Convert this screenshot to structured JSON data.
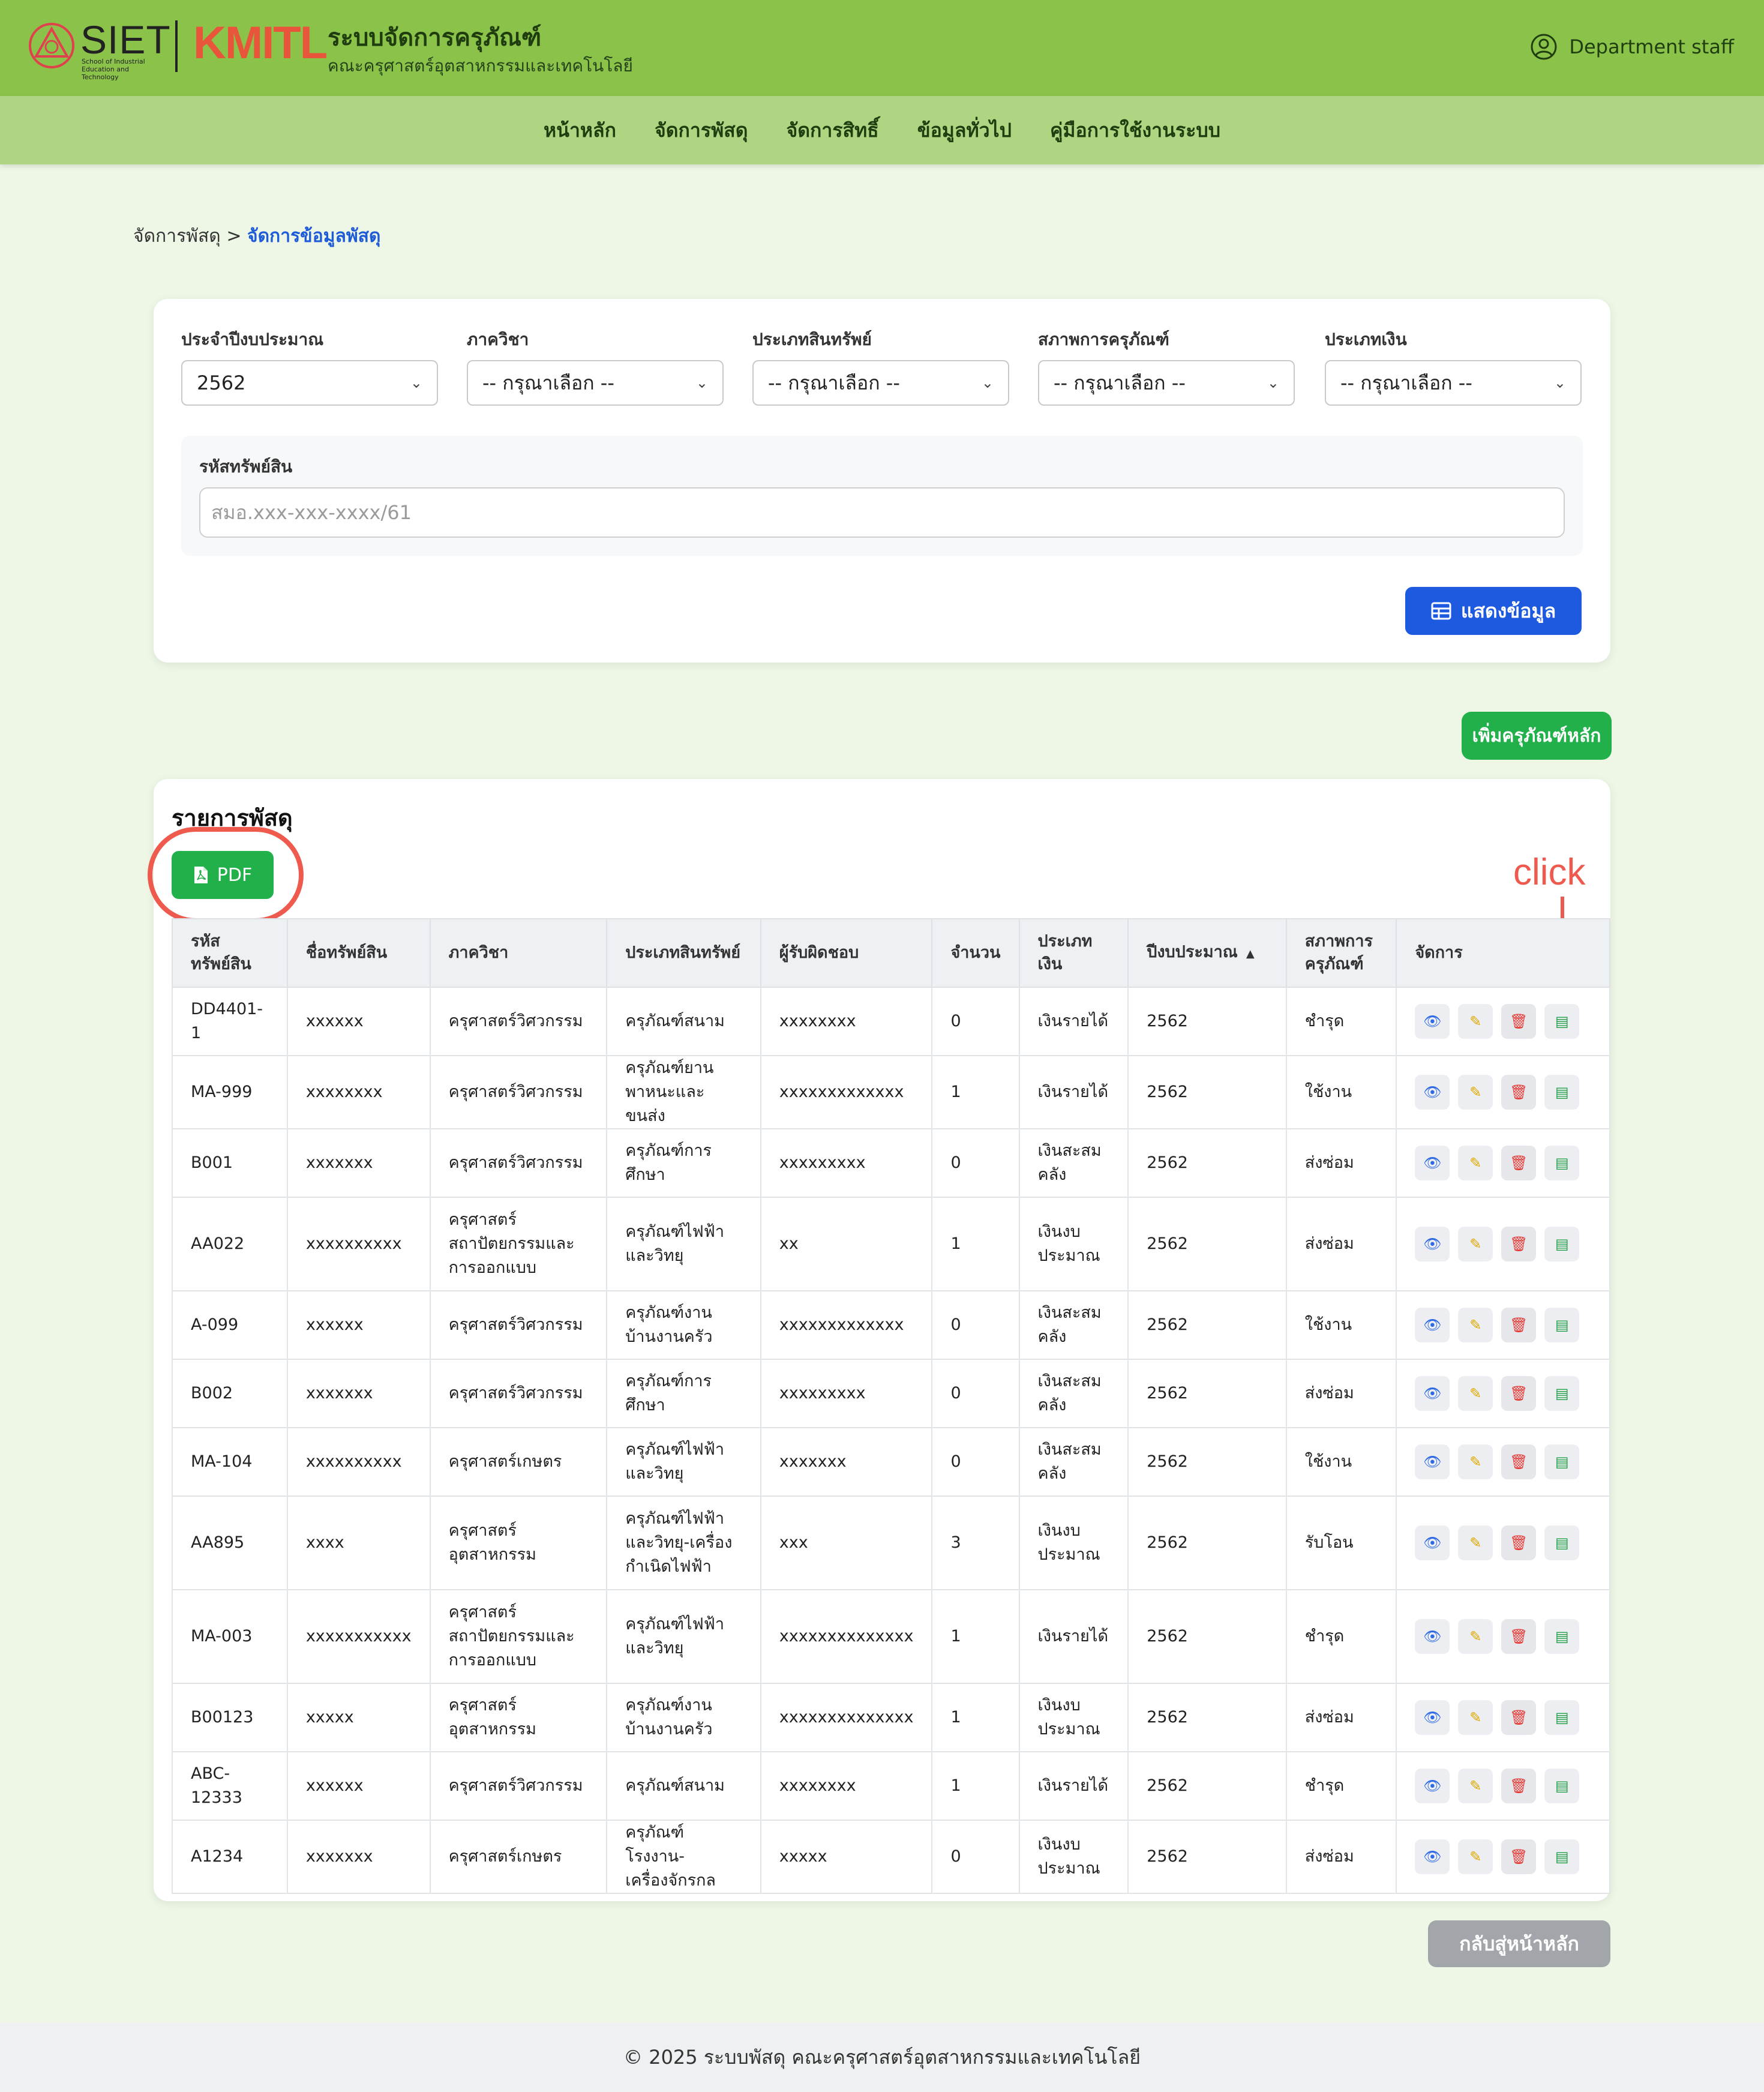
{
  "header": {
    "logo_siet": "SIET",
    "logo_siet_sub": "School of Industrial Education and Technology",
    "logo_kmitl": "KMITL",
    "system_title": "ระบบจัดการครุภัณฑ์",
    "system_subtitle": "คณะครุศาสตร์อุตสาหกรรมและเทคโนโลยี",
    "user_label": "Department staff"
  },
  "nav": {
    "items": [
      "หน้าหลัก",
      "จัดการพัสดุ",
      "จัดการสิทธิ์",
      "ข้อมูลทั่วไป",
      "คู่มือการใช้งานระบบ"
    ]
  },
  "breadcrumb": {
    "parent": "จัดการพัสดุ",
    "separator": ">",
    "current": "จัดการข้อมูลพัสดุ"
  },
  "filters": {
    "fiscal_year_label": "ประจำปีงบประมาณ",
    "fiscal_year_value": "2562",
    "department_label": "ภาควิชา",
    "department_value": "-- กรุณาเลือก --",
    "asset_type_label": "ประเภทสินทรัพย์",
    "asset_type_value": "-- กรุณาเลือก --",
    "condition_label": "สภาพการครุภัณฑ์",
    "condition_value": "-- กรุณาเลือก --",
    "money_type_label": "ประเภทเงิน",
    "money_type_value": "-- กรุณาเลือก --",
    "asset_code_label": "รหัสทรัพย์สิน",
    "asset_code_placeholder": "สมอ.xxx-xxx-xxxx/61",
    "show_button": "แสดงข้อมูล"
  },
  "add_button": "เพิ่มครุภัณฑ์หลัก",
  "list": {
    "title": "รายการพัสดุ",
    "pdf_button": "PDF",
    "annotation": "click",
    "columns": [
      "รหัส ทรัพย์สิน",
      "ชื่อทรัพย์สิน",
      "ภาควิชา",
      "ประเภทสินทรัพย์",
      "ผู้รับผิดชอบ",
      "จำนวน",
      "ประเภท เงิน",
      "ปีงบประมาณ",
      "สภาพการ ครุภัณฑ์",
      "จัดการ"
    ],
    "rows": [
      [
        "DD4401-1",
        "xxxxxx",
        "ครุศาสตร์วิศวกรรม",
        "ครุภัณฑ์สนาม",
        "xxxxxxxx",
        "0",
        "เงินรายได้",
        "2562",
        "ชำรุด"
      ],
      [
        "MA-999",
        "xxxxxxxx",
        "ครุศาสตร์วิศวกรรม",
        "ครุภัณฑ์ยานพาหนะและขนส่ง",
        "xxxxxxxxxxxxx",
        "1",
        "เงินรายได้",
        "2562",
        "ใช้งาน"
      ],
      [
        "B001",
        "xxxxxxx",
        "ครุศาสตร์วิศวกรรม",
        "ครุภัณฑ์การศึกษา",
        "xxxxxxxxx",
        "0",
        "เงินสะสมคลัง",
        "2562",
        "ส่งซ่อม"
      ],
      [
        "AA022",
        "xxxxxxxxxx",
        "ครุศาสตร์สถาปัตยกรรมและการออกแบบ",
        "ครุภัณฑ์ไฟฟ้าและวิทยุ",
        "xx",
        "1",
        "เงินงบประมาณ",
        "2562",
        "ส่งซ่อม"
      ],
      [
        "A-099",
        "xxxxxx",
        "ครุศาสตร์วิศวกรรม",
        "ครุภัณฑ์งานบ้านงานครัว",
        "xxxxxxxxxxxxx",
        "0",
        "เงินสะสมคลัง",
        "2562",
        "ใช้งาน"
      ],
      [
        "B002",
        "xxxxxxx",
        "ครุศาสตร์วิศวกรรม",
        "ครุภัณฑ์การศึกษา",
        "xxxxxxxxx",
        "0",
        "เงินสะสมคลัง",
        "2562",
        "ส่งซ่อม"
      ],
      [
        "MA-104",
        "xxxxxxxxxx",
        "ครุศาสตร์เกษตร",
        "ครุภัณฑ์ไฟฟ้าและวิทยุ",
        "xxxxxxx",
        "0",
        "เงินสะสมคลัง",
        "2562",
        "ใช้งาน"
      ],
      [
        "AA895",
        "xxxx",
        "ครุศาสตร์อุตสาหกรรม",
        "ครุภัณฑ์ไฟฟ้าและวิทยุ-เครื่องกำเนิดไฟฟ้า",
        "xxx",
        "3",
        "เงินงบประมาณ",
        "2562",
        "รับโอน"
      ],
      [
        "MA-003",
        "xxxxxxxxxxx",
        "ครุศาสตร์สถาปัตยกรรมและการออกแบบ",
        "ครุภัณฑ์ไฟฟ้าและวิทยุ",
        "xxxxxxxxxxxxxx",
        "1",
        "เงินรายได้",
        "2562",
        "ชำรุด"
      ],
      [
        "B00123",
        "xxxxx",
        "ครุศาสตร์อุตสาหกรรม",
        "ครุภัณฑ์งานบ้านงานครัว",
        "xxxxxxxxxxxxxx",
        "1",
        "เงินงบประมาณ",
        "2562",
        "ส่งซ่อม"
      ],
      [
        "ABC-12333",
        "xxxxxx",
        "ครุศาสตร์วิศวกรรม",
        "ครุภัณฑ์สนาม",
        "xxxxxxxx",
        "1",
        "เงินรายได้",
        "2562",
        "ชำรุด"
      ],
      [
        "A1234",
        "xxxxxxx",
        "ครุศาสตร์เกษตร",
        "ครุภัณฑ์โรงงาน-เครื่องจักรกล",
        "xxxxx",
        "0",
        "เงินงบประมาณ",
        "2562",
        "ส่งซ่อม"
      ]
    ]
  },
  "back_button": "กลับสู่หน้าหลัก",
  "footer": "© 2025 ระบบพัสดุ คณะครุศาสตร์อุตสาหกรรมและเทคโนโลยี",
  "colors": {
    "header_bg": "#8bc34a",
    "nav_bg": "#aed581",
    "primary_blue": "#1d5ae0",
    "success_green": "#22b04b",
    "annotation_red": "#ef5a4f"
  }
}
